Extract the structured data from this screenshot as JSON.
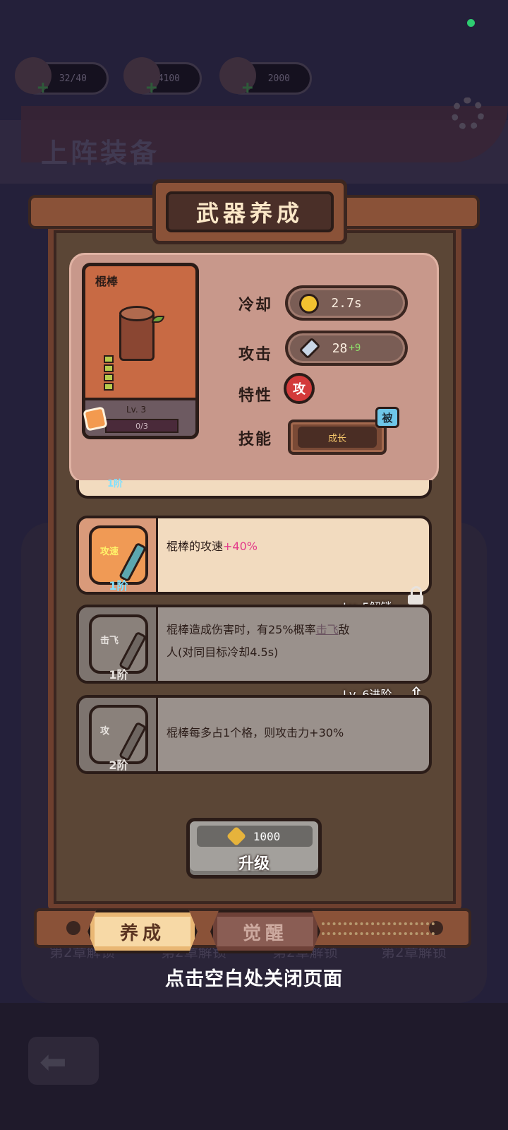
{
  "background": {
    "resources": [
      {
        "icon": "heart-icon",
        "value": "32/40"
      },
      {
        "icon": "key-icon",
        "value": "4100"
      },
      {
        "icon": "swirl-icon",
        "value": "2000"
      }
    ],
    "section_title": "上阵装备",
    "card_unlock_labels": [
      "第2章解锁",
      "第2章解锁",
      "第2章解锁",
      "第2章解锁"
    ]
  },
  "dialog": {
    "title": "武器养成",
    "weapon": {
      "name": "棍棒",
      "level": "Lv. 3",
      "fragments": "0/3"
    },
    "stats": {
      "cooldown_label": "冷却",
      "cooldown_value": "2.7s",
      "attack_label": "攻击",
      "attack_value": "28",
      "attack_bonus": "+9",
      "trait_label": "特性",
      "trait_badge": "攻",
      "skill_label": "技能",
      "skill_name": "成长",
      "skill_tag": "被"
    },
    "partial_row_tier": "1阶",
    "upgrades": [
      {
        "tag": "攻速",
        "tier": "1阶",
        "desc_pre": "棍棒的攻速",
        "desc_value": "+40%",
        "state": "active"
      },
      {
        "tag": "击飞",
        "tier": "1阶",
        "requirement": "Lv. 5解锁",
        "desc_line1_pre": "棍棒造成伤害时，有25%概率",
        "desc_keyword": "击飞",
        "desc_line1_post": "敌",
        "desc_line2": "人(对同目标冷却4.5s)",
        "state": "locked"
      },
      {
        "tag": "攻",
        "tier": "2阶",
        "requirement": "Lv. 6进阶",
        "desc": "棍棒每多占1个格，则攻击力+30%",
        "state": "locked"
      }
    ],
    "upgrade_button": {
      "cost": "1000",
      "label": "升级"
    },
    "tabs": [
      {
        "label": "养成",
        "active": true
      },
      {
        "label": "觉醒",
        "active": false
      }
    ],
    "close_hint": "点击空白处关闭页面"
  }
}
